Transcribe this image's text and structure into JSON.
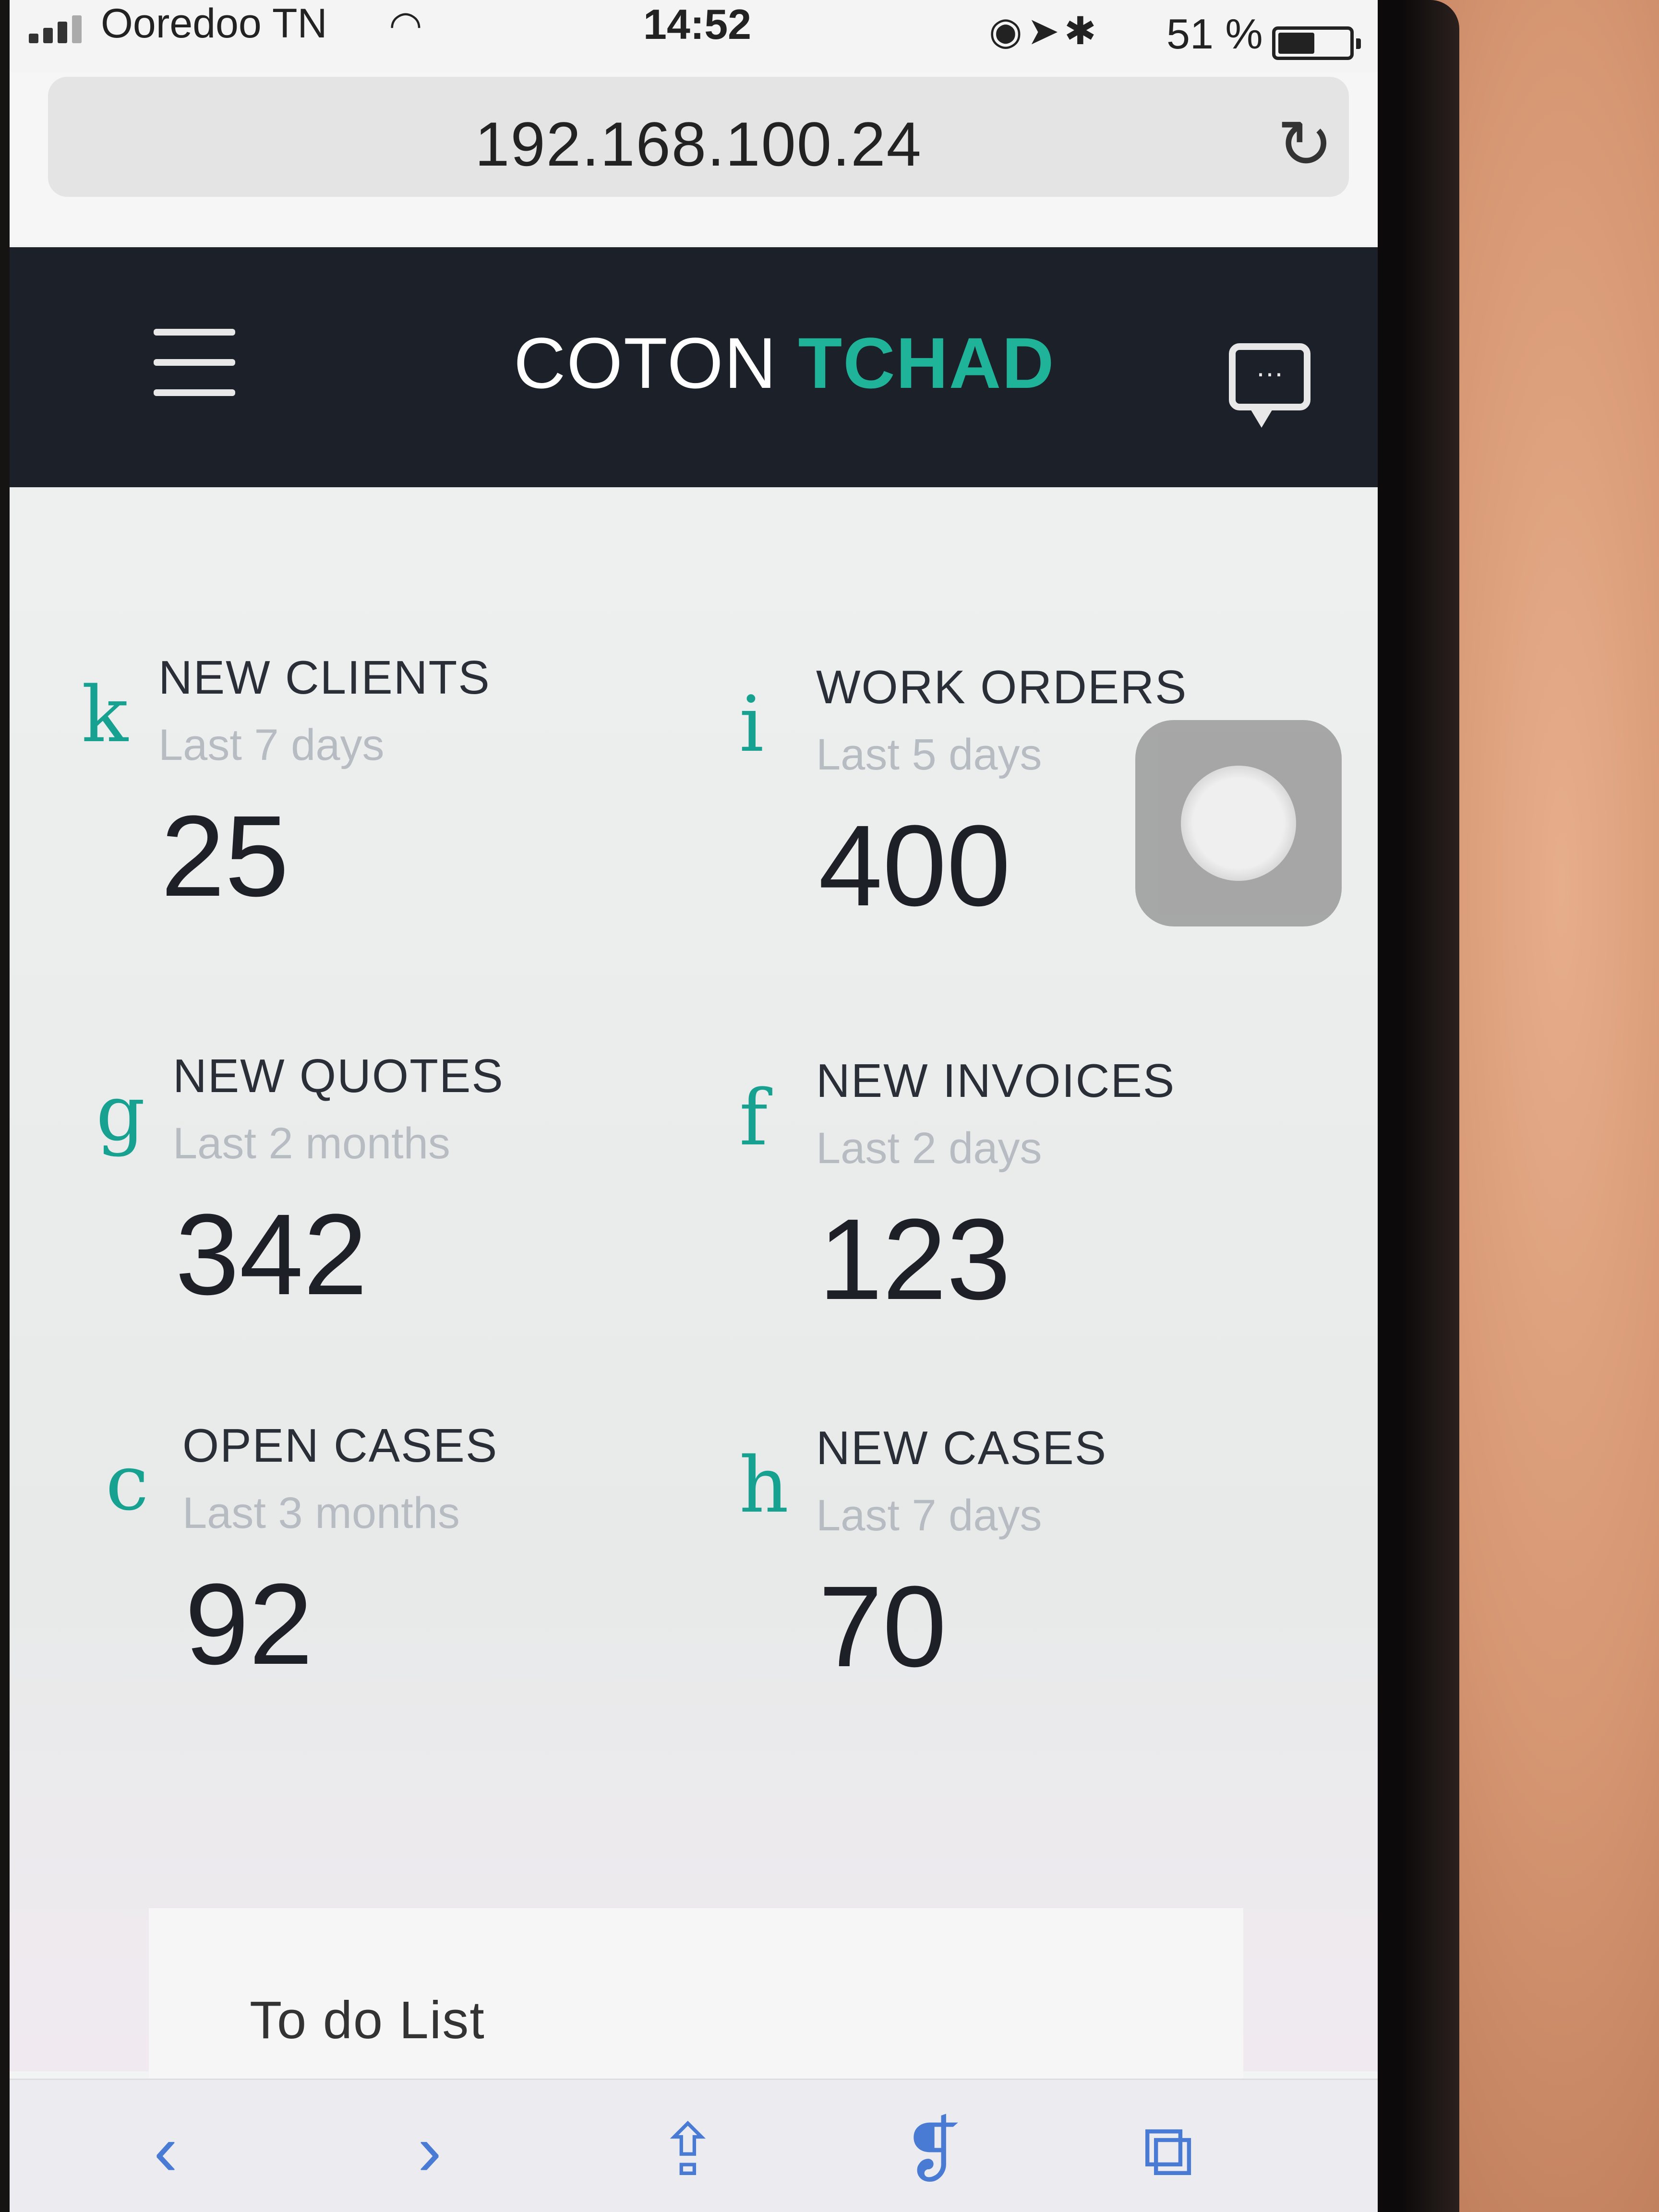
{
  "status_bar": {
    "carrier": "Ooredoo TN",
    "time": "14:52",
    "battery": "51 %",
    "icons": [
      "signal-icon",
      "wifi-icon",
      "orientation-lock-icon",
      "location-icon",
      "bluetooth-icon",
      "battery-icon"
    ]
  },
  "browser": {
    "url": "192.168.100.24",
    "reload_icon": "reload-icon"
  },
  "header": {
    "brand_part1": "COTON ",
    "brand_part2": "TCHAD",
    "menu_icon": "hamburger-menu-icon",
    "chat_icon": "chat-bubble-icon"
  },
  "stats": [
    {
      "icon": "k",
      "title": "NEW CLIENTS",
      "period": "Last 7 days",
      "value": "25"
    },
    {
      "icon": "i",
      "title": "WORK ORDERS",
      "period": "Last 5 days",
      "value": "400"
    },
    {
      "icon": "g",
      "title": "NEW QUOTES",
      "period": "Last 2 months",
      "value": "342"
    },
    {
      "icon": "f",
      "title": "NEW INVOICES",
      "period": "Last 2 days",
      "value": "123"
    },
    {
      "icon": "c",
      "title": "OPEN CASES",
      "period": "Last 3 months",
      "value": "92"
    },
    {
      "icon": "h",
      "title": "NEW CASES",
      "period": "Last 7 days",
      "value": "70"
    }
  ],
  "todo": {
    "title": "To do List"
  },
  "toolbar": {
    "items": [
      "back-icon",
      "forward-icon",
      "share-icon",
      "bookmarks-icon",
      "tabs-icon"
    ]
  },
  "colors": {
    "header_bg": "#1c2129",
    "accent": "#1fb39a",
    "icon_teal": "#17a190"
  }
}
